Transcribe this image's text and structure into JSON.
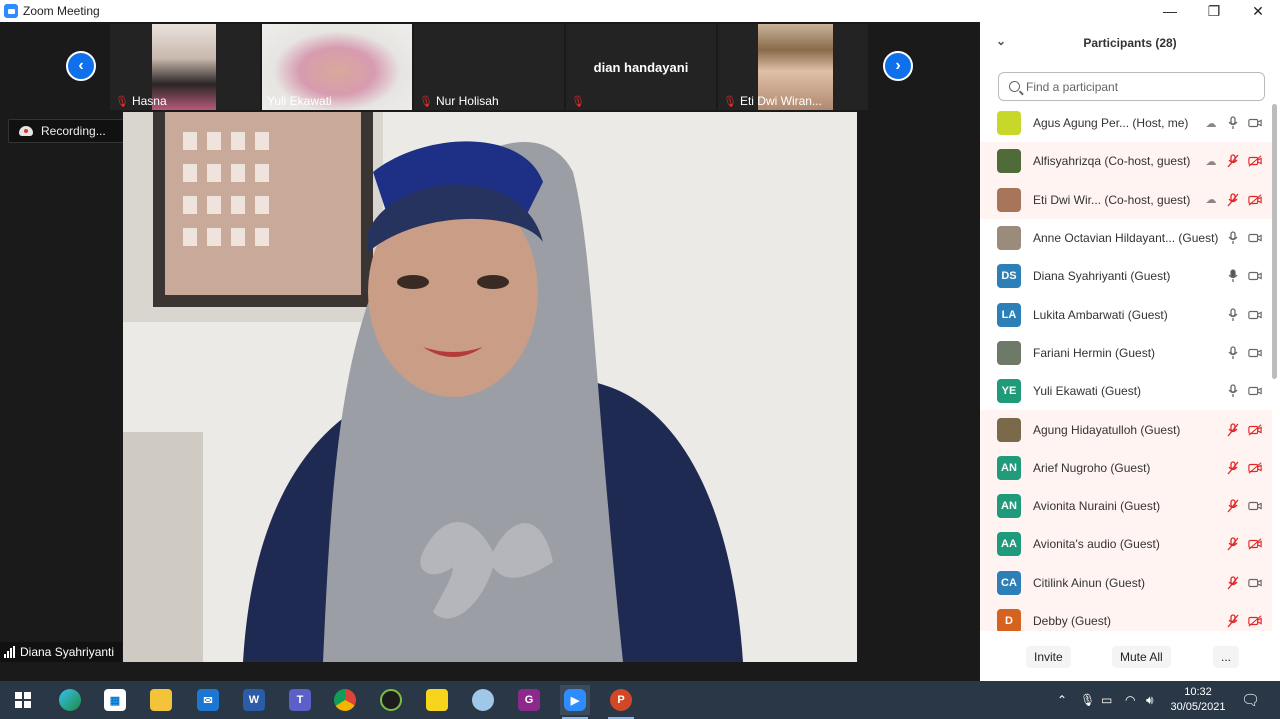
{
  "window": {
    "title": "Zoom Meeting"
  },
  "gallery": {
    "thumbs": [
      {
        "name": "Hasna"
      },
      {
        "name": "Yuli Ekawati"
      },
      {
        "name": "Nur Holisah"
      },
      {
        "name": "dian handayani"
      },
      {
        "name": "Eti Dwi Wiran..."
      }
    ]
  },
  "recording": {
    "label": "Recording..."
  },
  "active_speaker": {
    "name": "Diana Syahriyanti"
  },
  "participants_panel": {
    "title": "Participants (28)",
    "search_placeholder": "Find a participant",
    "participants": [
      {
        "name": "Agus Agung Per...",
        "role": "(Host, me)",
        "initials": "",
        "color": "#c8d82a",
        "audio": "on",
        "video": "on"
      },
      {
        "name": "Alfisyahrizqa",
        "role": "(Co-host, guest)",
        "initials": "",
        "color": "#4f6b3a",
        "audio": "muted",
        "video": "off"
      },
      {
        "name": "Eti Dwi Wir...",
        "role": "(Co-host, guest)",
        "initials": "",
        "color": "#a7765a",
        "audio": "muted",
        "video": "off"
      },
      {
        "name": "Anne Octavian Hildayant...",
        "role": "(Guest)",
        "initials": "",
        "color": "#9a8b7a",
        "audio": "on",
        "video": "on"
      },
      {
        "name": "Diana Syahriyanti",
        "role": "(Guest)",
        "initials": "DS",
        "color": "#2d7fb8",
        "audio": "speaking",
        "video": "on"
      },
      {
        "name": "Lukita Ambarwati",
        "role": "(Guest)",
        "initials": "LA",
        "color": "#2d7fb8",
        "audio": "on",
        "video": "on"
      },
      {
        "name": "Fariani Hermin",
        "role": "(Guest)",
        "initials": "",
        "color": "#6e7a68",
        "audio": "on",
        "video": "on"
      },
      {
        "name": "Yuli Ekawati",
        "role": "(Guest)",
        "initials": "YE",
        "color": "#1f9a7a",
        "audio": "on",
        "video": "on"
      },
      {
        "name": "Agung Hidayatulloh",
        "role": "(Guest)",
        "initials": "",
        "color": "#7a6a4a",
        "audio": "muted",
        "video": "off"
      },
      {
        "name": "Arief Nugroho",
        "role": "(Guest)",
        "initials": "AN",
        "color": "#1f9a7a",
        "audio": "muted",
        "video": "off"
      },
      {
        "name": "Avionita Nuraini",
        "role": "(Guest)",
        "initials": "AN",
        "color": "#1f9a7a",
        "audio": "muted",
        "video": "on"
      },
      {
        "name": "Avionita's audio",
        "role": "(Guest)",
        "initials": "AA",
        "color": "#1f9a7a",
        "audio": "muted",
        "video": "off"
      },
      {
        "name": "Citilink Ainun",
        "role": "(Guest)",
        "initials": "CA",
        "color": "#2d7fb8",
        "audio": "muted",
        "video": "on"
      },
      {
        "name": "Debby",
        "role": "(Guest)",
        "initials": "D",
        "color": "#d5621f",
        "audio": "muted",
        "video": "off"
      }
    ],
    "footer": {
      "invite": "Invite",
      "mute_all": "Mute All",
      "more": "..."
    }
  },
  "taskbar": {
    "time": "10:32",
    "date": "30/05/2021"
  }
}
